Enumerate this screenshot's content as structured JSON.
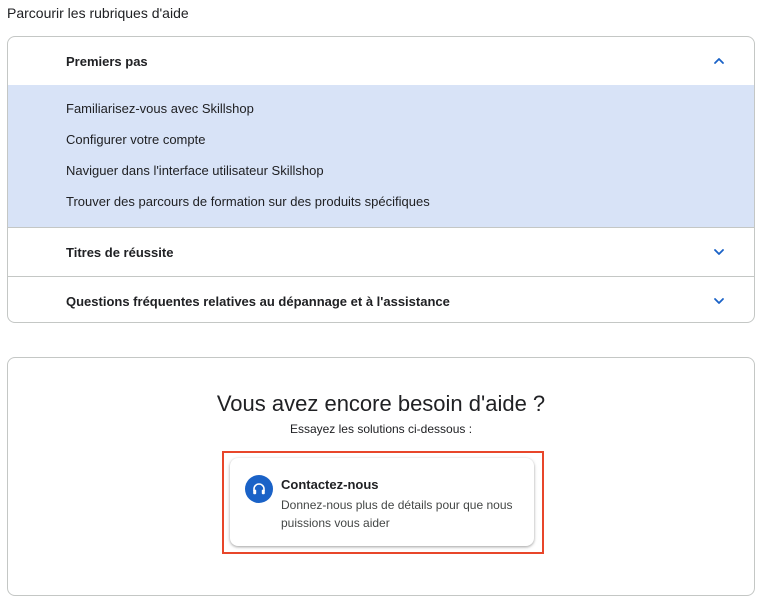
{
  "section_heading": "Parcourir les rubriques d'aide",
  "accordion": {
    "sections": [
      {
        "title": "Premiers pas",
        "expanded": true,
        "links": [
          "Familiarisez-vous avec Skillshop",
          "Configurer votre compte",
          "Naviguer dans l'interface utilisateur Skillshop",
          "Trouver des parcours de formation sur des produits spécifiques"
        ]
      },
      {
        "title": "Titres de réussite",
        "expanded": false
      },
      {
        "title": "Questions fréquentes relatives au dépannage et à l'assistance",
        "expanded": false
      }
    ]
  },
  "help": {
    "title": "Vous avez encore besoin d'aide ?",
    "subtitle": "Essayez les solutions ci-dessous :",
    "contact": {
      "icon": "headset-icon",
      "title": "Contactez-nous",
      "description": "Donnez-nous plus de détails pour que nous puissions vous aider"
    }
  },
  "colors": {
    "accent": "#1a62c7",
    "expanded_bg": "#d8e3f7",
    "highlight_border": "#e8462a",
    "border": "#c4c7c5"
  }
}
